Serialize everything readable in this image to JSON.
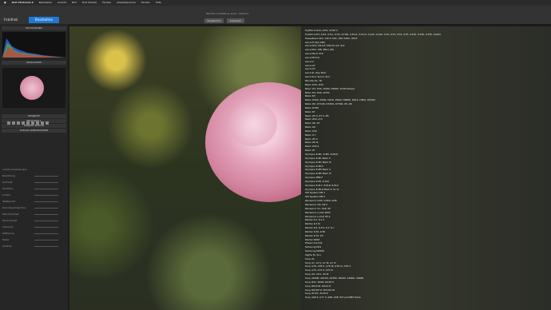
{
  "menubar": {
    "items": [
      "DxO PhotoLab 6",
      "Bearbeiten",
      "Ansicht",
      "Bild",
      "DxO Module",
      "Fenster",
      "Arbeitsbereiche",
      "Fenster",
      "Hilfe"
    ]
  },
  "window_title": "Test Dxl 3.0 RAW ex vivid – DSCF11",
  "toolbar": {
    "photothek": "Fotothek",
    "bearbeiten": "Bearbeiten",
    "vergleichen": "Vergleichen",
    "zoom": "Anpassen"
  },
  "left_panel": {
    "histogram_title": "HISTOGRAMM",
    "nav_title": "NAVIGATION",
    "sections": [
      "PROJEKTE",
      "PROTOKOLL",
      "PROJEKT EDITOR",
      "LOKALE ANPASSUNGEN"
    ],
    "adjust_rows": [
      "Lokale Anpassungen",
      "Belichtung",
      "Kontrast",
      "Schatten",
      "Lichter",
      "Weißpunkt",
      "DxO ClearView Plus",
      "Mikrokontrast",
      "Feinkontrast",
      "Vibrance",
      "Sättigung",
      "Farbe",
      "Schärfe"
    ]
  },
  "lens_list": [
    "Fujifilm X-S10, X-E4, X-T30 II",
    "Fujifilm X-E3, X-E4, X-H1, X-H2, X-H2S, X-Pro2, X-Pro3, X-S10, X-S20, X-T2, X-T3, X-T4, X-T5, X-T20, X-T30, X-T50, X100V",
    "Hasselblad X1D, X1D II 50C, X2D 100C, 907X",
    "Leica M (Typ 240)",
    "Leica M10, M10-P, M10-R, Q2, SL2",
    "Leica M11, M8, M8.2, M9",
    "Leica M9-P, M-E",
    "Leica M10-D",
    "Leica Q",
    "Leica Q2",
    "Leica Q3",
    "Leica SL (Typ 601)",
    "Leica SL2, SL2-S, SL3",
    "Minolta A5, 7D",
    "Nikon D3X, D3S",
    "Nikon D3, D3S, D300, D300S, D700 Mosaic",
    "Nikon D4, D4S, D750",
    "Nikon D5",
    "Nikon D500, D600, D610, D800, D800E, D810, D850, D5300",
    "Nikon D6, D7100, D7200, D7500, Z5, Z6",
    "Nikon D780",
    "Nikon Df",
    "Nikon Z6 II, Z7 II, Z8",
    "Nikon Z50, Z fc",
    "Nikon Z6, Z7",
    "Nikon Z9",
    "Nikon Z30",
    "Nikon Z f",
    "Nikon Z5 II",
    "Nikon Z6 III",
    "Nikon Z50 II",
    "Nikon Zf",
    "Olympus E-M1, E-M5, E-M10",
    "Olympus E-M1 Mark II",
    "Olympus E-M1 Mark III",
    "Olympus E-M1X",
    "Olympus E-M5 Mark II",
    "Olympus E-M5 Mark III",
    "Olympus PEN-F",
    "Olympus E-P5, E-PL5",
    "Olympus E-PL7, E-PL8, E-PL9",
    "Olympus E-M10 Mark II, III, IV",
    "OM System OM-1",
    "OM System OM-5",
    "Panasonic GH5, GH5S, GH6",
    "Panasonic G9, G9 II",
    "Panasonic S1, S1R, S5",
    "Panasonic Lumix DMC",
    "Panasonic Lumix S5 II",
    "Pentax K-1, K-1 II",
    "Pentax K-3 III",
    "Pentax K-5, K-5 II, K-7, K-r",
    "Pentax K-30, K-50",
    "Pentax K-70, KP",
    "Pentax 645Z",
    "Phase One IQ4",
    "Samsung NX1",
    "Samsung NX500",
    "Sigma fp, fp L",
    "Sony A1",
    "Sony A7, A7 II, A7 III, A7 IV",
    "Sony A7R, A7R II, A7R III, A7R IV, A7R V",
    "Sony A7S, A7S II, A7S III",
    "Sony A9, A9 II, A9 III",
    "Sony A6000, A6100, A6300, A6400, A6500, A6600",
    "Sony RX1, RX1R, RX1R II",
    "Sony RX10 III, RX10 IV",
    "Sony RX100 VI, RX100 VII",
    "Sony ZV-E1, ZV-E10",
    "Sony A99 II, A77 II, A68, A58, SLT and NEX Serie"
  ]
}
